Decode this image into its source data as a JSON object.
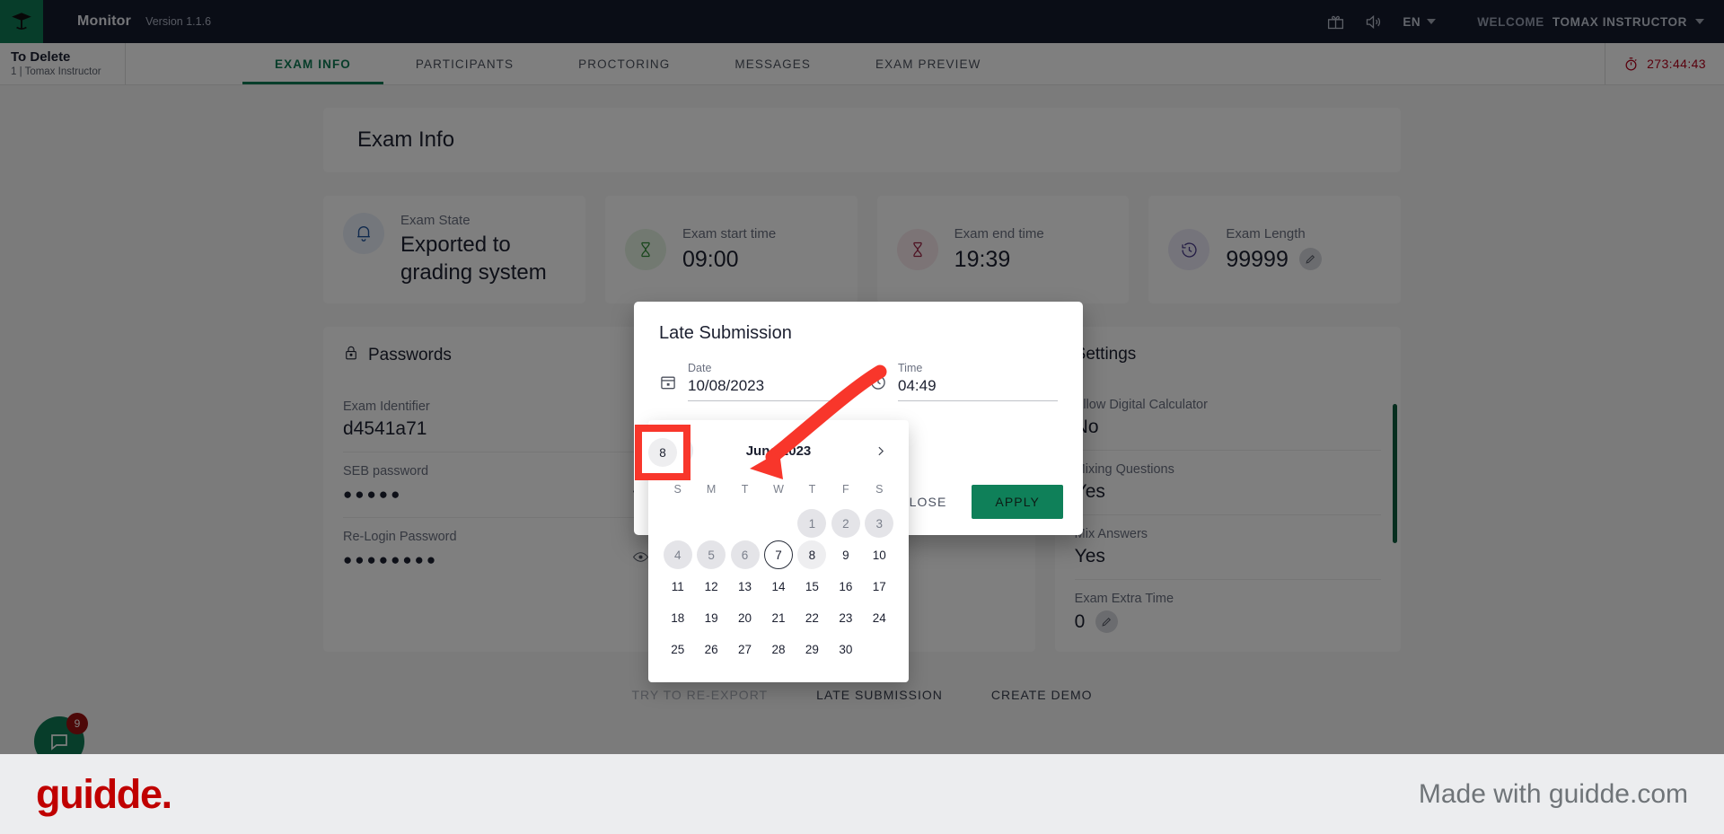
{
  "topbar": {
    "app_name": "Monitor",
    "version": "Version 1.1.6",
    "gift_icon": "gift-icon",
    "sound_icon": "speaker-icon",
    "language": "EN",
    "welcome_prefix": "WELCOME",
    "welcome_user": "TOMAX INSTRUCTOR"
  },
  "examheader": {
    "title": "To Delete",
    "subtitle": "1  |  Tomax Instructor",
    "timer": "273:44:43"
  },
  "tabs": [
    {
      "label": "EXAM INFO",
      "active": true
    },
    {
      "label": "PARTICIPANTS",
      "active": false
    },
    {
      "label": "PROCTORING",
      "active": false
    },
    {
      "label": "MESSAGES",
      "active": false
    },
    {
      "label": "EXAM PREVIEW",
      "active": false
    }
  ],
  "page": {
    "title": "Exam Info"
  },
  "info_cards": [
    {
      "label": "Exam State",
      "value": "Exported to grading system",
      "icon": "bell-icon"
    },
    {
      "label": "Exam start time",
      "value": "09:00",
      "icon": "hourglass-icon"
    },
    {
      "label": "Exam end time",
      "value": "19:39",
      "icon": "hourglass-icon"
    },
    {
      "label": "Exam Length",
      "value": "99999",
      "icon": "history-icon",
      "editable": true
    }
  ],
  "passwords": {
    "title": "Passwords",
    "icon": "lock-icon",
    "rows": [
      {
        "key": "Exam Identifier",
        "value": "d4541a71",
        "eye": false
      },
      {
        "key": "SEB password",
        "value": "●●●●●",
        "eye": true
      },
      {
        "key": "Re-Login Password",
        "value": "●●●●●●●●",
        "eye": true
      }
    ]
  },
  "settings": {
    "title": "Settings",
    "rows": [
      {
        "key": "Allow Digital Calculator",
        "value": "No"
      },
      {
        "key": "Mixing Questions",
        "value": "Yes"
      },
      {
        "key": "Mix Answers",
        "value": "Yes"
      },
      {
        "key": "Exam Extra Time",
        "value": "0",
        "editable": true
      }
    ]
  },
  "action_buttons": [
    {
      "label": "TRY TO RE-EXPORT",
      "disabled": true
    },
    {
      "label": "LATE SUBMISSION",
      "disabled": false
    },
    {
      "label": "CREATE DEMO",
      "disabled": false
    }
  ],
  "fab": {
    "badge": "9",
    "icon": "chat-icon"
  },
  "modal": {
    "title": "Late Submission",
    "date_label": "Date",
    "date_value": "10/08/2023",
    "date_icon": "calendar-icon",
    "time_label": "Time",
    "time_value": "04:49",
    "time_icon": "clock-icon",
    "close_label": "CLOSE",
    "apply_label": "APPLY"
  },
  "calendar": {
    "month_title": "June 2023",
    "prev_icon": "chevron-left-icon",
    "next_icon": "chevron-right-icon",
    "dow": [
      "S",
      "M",
      "T",
      "W",
      "T",
      "F",
      "S"
    ],
    "lead_blanks": 4,
    "days": [
      {
        "n": "1",
        "state": "muted"
      },
      {
        "n": "2",
        "state": "muted"
      },
      {
        "n": "3",
        "state": "muted"
      },
      {
        "n": "4",
        "state": "muted"
      },
      {
        "n": "5",
        "state": "muted"
      },
      {
        "n": "6",
        "state": "muted"
      },
      {
        "n": "7",
        "state": "today"
      },
      {
        "n": "8",
        "state": "sel"
      },
      {
        "n": "9",
        "state": ""
      },
      {
        "n": "10",
        "state": ""
      },
      {
        "n": "11",
        "state": ""
      },
      {
        "n": "12",
        "state": ""
      },
      {
        "n": "13",
        "state": ""
      },
      {
        "n": "14",
        "state": ""
      },
      {
        "n": "15",
        "state": ""
      },
      {
        "n": "16",
        "state": ""
      },
      {
        "n": "17",
        "state": ""
      },
      {
        "n": "18",
        "state": ""
      },
      {
        "n": "19",
        "state": ""
      },
      {
        "n": "20",
        "state": ""
      },
      {
        "n": "21",
        "state": ""
      },
      {
        "n": "22",
        "state": ""
      },
      {
        "n": "23",
        "state": ""
      },
      {
        "n": "24",
        "state": ""
      },
      {
        "n": "25",
        "state": ""
      },
      {
        "n": "26",
        "state": ""
      },
      {
        "n": "27",
        "state": ""
      },
      {
        "n": "28",
        "state": ""
      },
      {
        "n": "29",
        "state": ""
      },
      {
        "n": "30",
        "state": ""
      }
    ],
    "highlight_day": "8"
  },
  "guidde": {
    "logo": "guidde.",
    "made_with": "Made with guidde.com"
  },
  "colors": {
    "brand_green": "#0f7a55",
    "highlight_red": "#f8362b",
    "timer_red": "#b3001b",
    "topbar_dark": "#151a2d",
    "guidde_red": "#c00000"
  }
}
